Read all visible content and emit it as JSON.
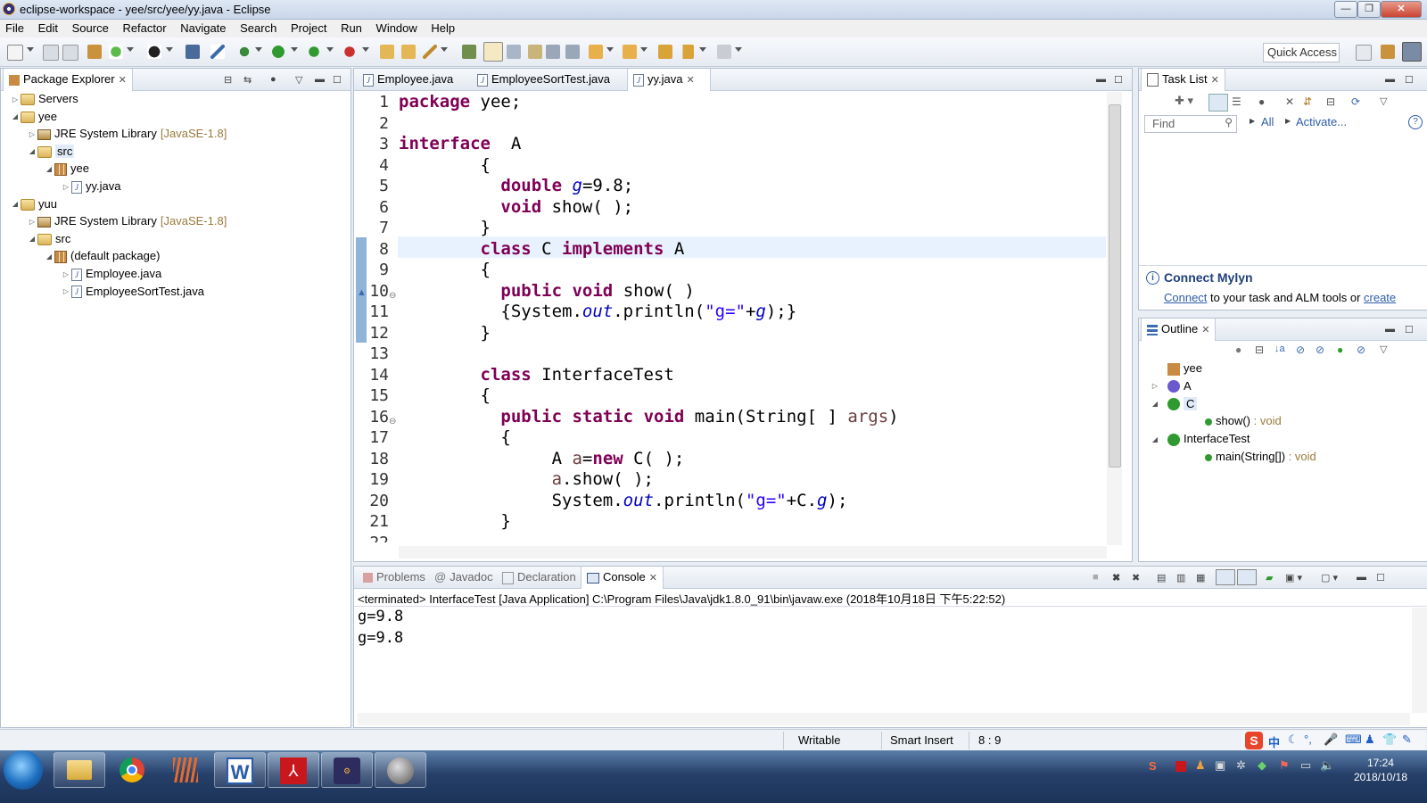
{
  "window": {
    "title": "eclipse-workspace - yee/src/yee/yy.java - Eclipse",
    "min_label": "—",
    "max_label": "❐",
    "close_label": "✕"
  },
  "menu": [
    "File",
    "Edit",
    "Source",
    "Refactor",
    "Navigate",
    "Search",
    "Project",
    "Run",
    "Window",
    "Help"
  ],
  "toolbar": {
    "quick_access": "Quick Access"
  },
  "package_explorer": {
    "tab_label": "Package Explorer",
    "tree": [
      {
        "label": "Servers",
        "level": 0,
        "icon": "folder-icon",
        "expander": "collapsed"
      },
      {
        "label": "yee",
        "level": 0,
        "icon": "project-icon",
        "expander": "expanded"
      },
      {
        "label": "JRE System Library",
        "suffix": "[JavaSE-1.8]",
        "level": 1,
        "icon": "library-icon",
        "expander": "collapsed"
      },
      {
        "label": "src",
        "level": 1,
        "icon": "source-folder-icon",
        "expander": "expanded",
        "selected": true
      },
      {
        "label": "yee",
        "level": 2,
        "icon": "package-icon",
        "expander": "expanded"
      },
      {
        "label": "yy.java",
        "level": 3,
        "icon": "java-file-icon",
        "expander": "collapsed"
      },
      {
        "label": "yuu",
        "level": 0,
        "icon": "project-icon",
        "expander": "expanded"
      },
      {
        "label": "JRE System Library",
        "suffix": "[JavaSE-1.8]",
        "level": 1,
        "icon": "library-icon",
        "expander": "collapsed"
      },
      {
        "label": "src",
        "level": 1,
        "icon": "source-folder-icon",
        "expander": "expanded"
      },
      {
        "label": "(default package)",
        "level": 2,
        "icon": "package-icon",
        "expander": "expanded"
      },
      {
        "label": "Employee.java",
        "level": 3,
        "icon": "java-file-icon",
        "expander": "collapsed"
      },
      {
        "label": "EmployeeSortTest.java",
        "level": 3,
        "icon": "java-file-icon",
        "expander": "collapsed"
      }
    ]
  },
  "editor": {
    "tabs": [
      {
        "label": "Employee.java",
        "active": false
      },
      {
        "label": "EmployeeSortTest.java",
        "active": false
      },
      {
        "label": "yy.java",
        "active": true
      }
    ],
    "current_line": 8,
    "lines": [
      [
        [
          "kw",
          "package"
        ],
        [
          "t",
          " yee;"
        ]
      ],
      [],
      [
        [
          "kw",
          "interface"
        ],
        [
          "t",
          "  A"
        ]
      ],
      [
        [
          "t",
          "        {"
        ]
      ],
      [
        [
          "t",
          "          "
        ],
        [
          "kw",
          "double"
        ],
        [
          "t",
          " "
        ],
        [
          "fld",
          "g"
        ],
        [
          "t",
          "=9.8;"
        ]
      ],
      [
        [
          "t",
          "          "
        ],
        [
          "kw",
          "void"
        ],
        [
          "t",
          " show( );"
        ]
      ],
      [
        [
          "t",
          "        }"
        ]
      ],
      [
        [
          "t",
          "        "
        ],
        [
          "kw",
          "class"
        ],
        [
          "t",
          " C "
        ],
        [
          "kw",
          "implements"
        ],
        [
          "t",
          " A"
        ]
      ],
      [
        [
          "t",
          "        {"
        ]
      ],
      [
        [
          "t",
          "          "
        ],
        [
          "kw",
          "public"
        ],
        [
          "t",
          " "
        ],
        [
          "kw",
          "void"
        ],
        [
          "t",
          " show( )"
        ]
      ],
      [
        [
          "t",
          "          {System."
        ],
        [
          "fld",
          "out"
        ],
        [
          "t",
          ".println("
        ],
        [
          "str",
          "\"g=\""
        ],
        [
          "t",
          "+"
        ],
        [
          "fld",
          "g"
        ],
        [
          "t",
          ");}"
        ]
      ],
      [
        [
          "t",
          "        }"
        ]
      ],
      [],
      [
        [
          "t",
          "        "
        ],
        [
          "kw",
          "class"
        ],
        [
          "t",
          " InterfaceTest"
        ]
      ],
      [
        [
          "t",
          "        {"
        ]
      ],
      [
        [
          "t",
          "          "
        ],
        [
          "kw",
          "public"
        ],
        [
          "t",
          " "
        ],
        [
          "kw",
          "static"
        ],
        [
          "t",
          " "
        ],
        [
          "kw",
          "void"
        ],
        [
          "t",
          " main(String[ ] "
        ],
        [
          "loc",
          "args"
        ],
        [
          "t",
          ")"
        ]
      ],
      [
        [
          "t",
          "          {"
        ]
      ],
      [
        [
          "t",
          "               A "
        ],
        [
          "loc",
          "a"
        ],
        [
          "t",
          "="
        ],
        [
          "kw",
          "new"
        ],
        [
          "t",
          " C( );"
        ]
      ],
      [
        [
          "t",
          "               "
        ],
        [
          "loc",
          "a"
        ],
        [
          "t",
          ".show( );"
        ]
      ],
      [
        [
          "t",
          "               System."
        ],
        [
          "fld",
          "out"
        ],
        [
          "t",
          ".println("
        ],
        [
          "str",
          "\"g=\""
        ],
        [
          "t",
          "+C."
        ],
        [
          "fld",
          "g"
        ],
        [
          "t",
          ");"
        ]
      ],
      [
        [
          "t",
          "          }"
        ]
      ],
      []
    ]
  },
  "task_list": {
    "tab_label": "Task List",
    "find_placeholder": "Find",
    "all_label": "All",
    "activate_label": "Activate...",
    "connect_title": "Connect Mylyn",
    "connect_link": "Connect",
    "connect_text": " to your task and ALM tools or ",
    "create_link": "create"
  },
  "outline": {
    "tab_label": "Outline",
    "items": [
      {
        "name": "yee",
        "suffix": "",
        "level": 0,
        "icon": "package-icon",
        "expander": ""
      },
      {
        "name": "A",
        "suffix": "",
        "level": 0,
        "icon": "interface-icon",
        "expander": "collapsed"
      },
      {
        "name": "C",
        "suffix": "",
        "level": 0,
        "icon": "class-icon",
        "expander": "expanded",
        "selected": true
      },
      {
        "name": "show()",
        "suffix": " : void",
        "level": 1,
        "icon": "method-icon",
        "expander": ""
      },
      {
        "name": "InterfaceTest",
        "suffix": "",
        "level": 0,
        "icon": "class-icon",
        "expander": "expanded"
      },
      {
        "name": "main(String[])",
        "suffix": " : void",
        "level": 1,
        "icon": "static-method-icon",
        "expander": ""
      }
    ]
  },
  "bottom_panel": {
    "tabs": [
      {
        "label": "Problems",
        "active": false
      },
      {
        "label": "Javadoc",
        "active": false
      },
      {
        "label": "Declaration",
        "active": false
      },
      {
        "label": "Console",
        "active": true
      }
    ],
    "console_header": "<terminated> InterfaceTest [Java Application] C:\\Program Files\\Java\\jdk1.8.0_91\\bin\\javaw.exe (2018年10月18日 下午5:22:52)",
    "console_output": [
      "g=9.8",
      "g=9.8"
    ]
  },
  "status_bar": {
    "writable": "Writable",
    "insert_mode": "Smart Insert",
    "position": "8 : 9"
  },
  "taskbar": {
    "time": "17:24",
    "date": "2018/10/18",
    "ime_label": "中"
  },
  "colors": {
    "keyword": "#7f0055",
    "field": "#0000c0",
    "string": "#2a00ff",
    "local": "#6a3e3e",
    "line_highlight": "#e8f2fe"
  }
}
